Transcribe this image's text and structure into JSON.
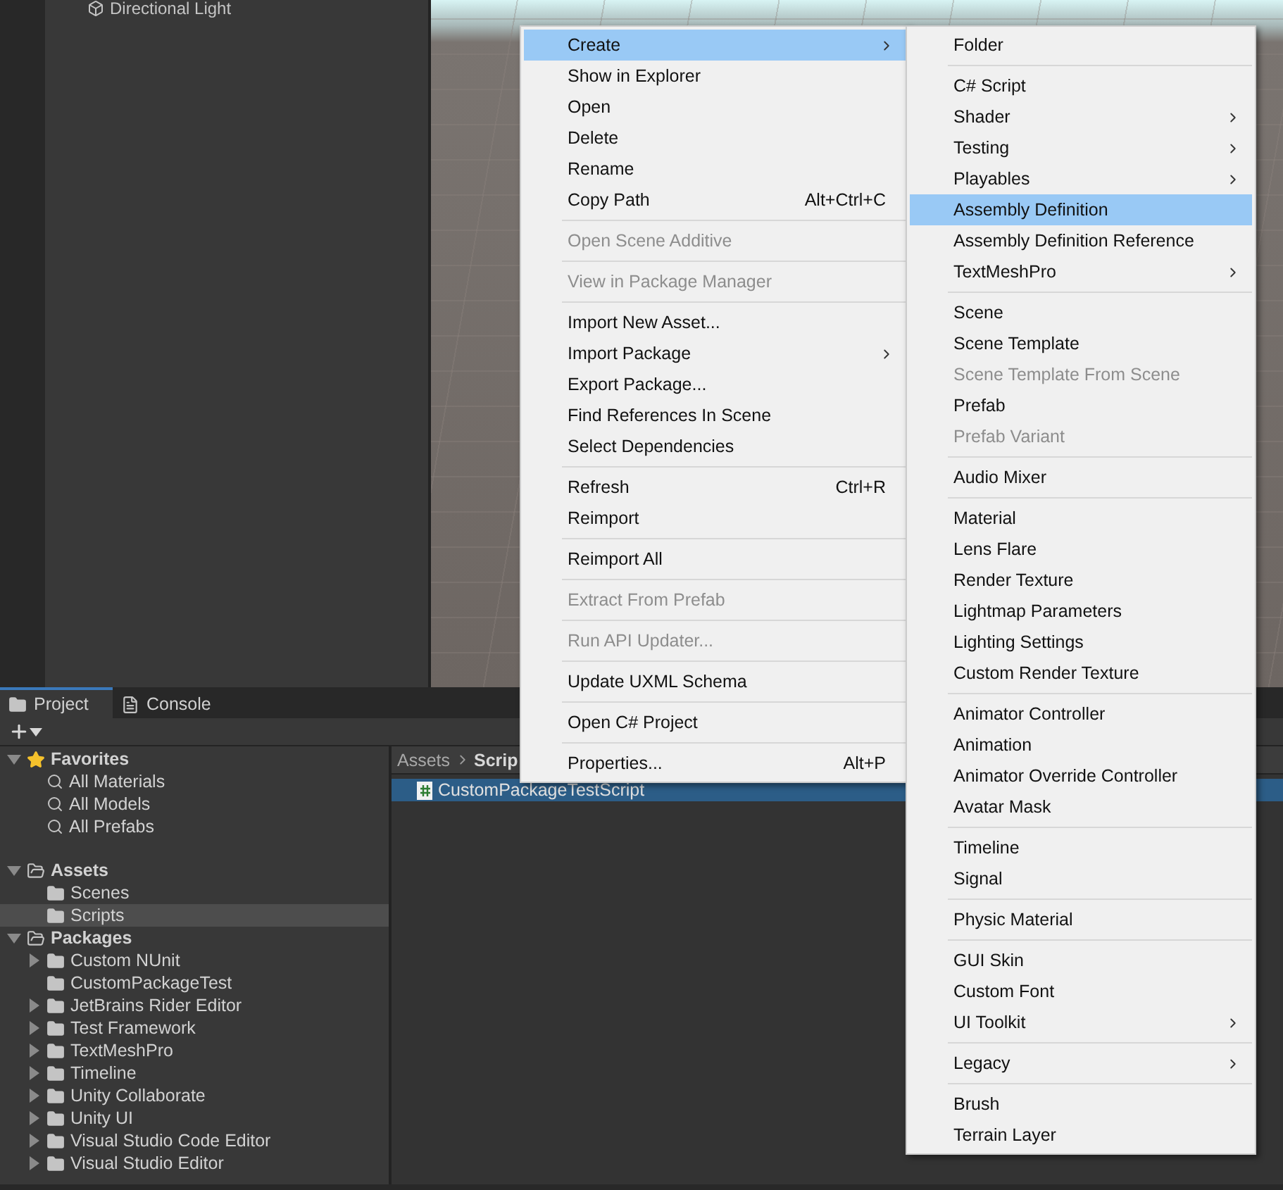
{
  "hierarchy": {
    "items": [
      {
        "label": "Directional Light"
      }
    ]
  },
  "bottom_panel": {
    "tabs": [
      {
        "label": "Project",
        "selected": true
      },
      {
        "label": "Console",
        "selected": false
      }
    ],
    "tree": [
      {
        "kind": "favorites",
        "label": "Favorites",
        "expandable": true,
        "expanded": true,
        "selected": false,
        "children": [
          {
            "kind": "search",
            "label": "All Materials",
            "expandable": false,
            "selected": false
          },
          {
            "kind": "search",
            "label": "All Models",
            "expandable": false,
            "selected": false
          },
          {
            "kind": "search",
            "label": "All Prefabs",
            "expandable": false,
            "selected": false
          }
        ]
      },
      {
        "kind": "folder",
        "label": "Assets",
        "expandable": true,
        "expanded": true,
        "selected": false,
        "children": [
          {
            "kind": "folder",
            "label": "Scenes",
            "expandable": false,
            "selected": false
          },
          {
            "kind": "folder",
            "label": "Scripts",
            "expandable": false,
            "selected": true
          }
        ]
      },
      {
        "kind": "folder",
        "label": "Packages",
        "expandable": true,
        "expanded": true,
        "selected": false,
        "children": [
          {
            "kind": "folder",
            "label": "Custom NUnit",
            "expandable": true,
            "expanded": false,
            "selected": false
          },
          {
            "kind": "folder",
            "label": "CustomPackageTest",
            "expandable": false,
            "selected": false
          },
          {
            "kind": "folder",
            "label": "JetBrains Rider Editor",
            "expandable": true,
            "expanded": false,
            "selected": false
          },
          {
            "kind": "folder",
            "label": "Test Framework",
            "expandable": true,
            "expanded": false,
            "selected": false
          },
          {
            "kind": "folder",
            "label": "TextMeshPro",
            "expandable": true,
            "expanded": false,
            "selected": false
          },
          {
            "kind": "folder",
            "label": "Timeline",
            "expandable": true,
            "expanded": false,
            "selected": false
          },
          {
            "kind": "folder",
            "label": "Unity Collaborate",
            "expandable": true,
            "expanded": false,
            "selected": false
          },
          {
            "kind": "folder",
            "label": "Unity UI",
            "expandable": true,
            "expanded": false,
            "selected": false
          },
          {
            "kind": "folder",
            "label": "Visual Studio Code Editor",
            "expandable": true,
            "expanded": false,
            "selected": false
          },
          {
            "kind": "folder",
            "label": "Visual Studio Editor",
            "expandable": true,
            "expanded": false,
            "selected": false
          }
        ]
      }
    ],
    "breadcrumb": [
      "Assets",
      "Scrip"
    ],
    "files": [
      {
        "label": "CustomPackageTestScript",
        "selected": true
      }
    ]
  },
  "context_menu": {
    "groups": [
      [
        {
          "label": "Create",
          "submenu": true,
          "selected": true,
          "disabled": false
        },
        {
          "label": "Show in Explorer",
          "submenu": false,
          "selected": false,
          "disabled": false
        },
        {
          "label": "Open",
          "submenu": false,
          "selected": false,
          "disabled": false
        },
        {
          "label": "Delete",
          "submenu": false,
          "selected": false,
          "disabled": false
        },
        {
          "label": "Rename",
          "submenu": false,
          "selected": false,
          "disabled": false
        },
        {
          "label": "Copy Path",
          "shortcut": "Alt+Ctrl+C",
          "submenu": false,
          "selected": false,
          "disabled": false
        }
      ],
      [
        {
          "label": "Open Scene Additive",
          "submenu": false,
          "selected": false,
          "disabled": true
        }
      ],
      [
        {
          "label": "View in Package Manager",
          "submenu": false,
          "selected": false,
          "disabled": true
        }
      ],
      [
        {
          "label": "Import New Asset...",
          "submenu": false,
          "selected": false,
          "disabled": false
        },
        {
          "label": "Import Package",
          "submenu": true,
          "selected": false,
          "disabled": false
        },
        {
          "label": "Export Package...",
          "submenu": false,
          "selected": false,
          "disabled": false
        },
        {
          "label": "Find References In Scene",
          "submenu": false,
          "selected": false,
          "disabled": false
        },
        {
          "label": "Select Dependencies",
          "submenu": false,
          "selected": false,
          "disabled": false
        }
      ],
      [
        {
          "label": "Refresh",
          "shortcut": "Ctrl+R",
          "submenu": false,
          "selected": false,
          "disabled": false
        },
        {
          "label": "Reimport",
          "submenu": false,
          "selected": false,
          "disabled": false
        }
      ],
      [
        {
          "label": "Reimport All",
          "submenu": false,
          "selected": false,
          "disabled": false
        }
      ],
      [
        {
          "label": "Extract From Prefab",
          "submenu": false,
          "selected": false,
          "disabled": true
        }
      ],
      [
        {
          "label": "Run API Updater...",
          "submenu": false,
          "selected": false,
          "disabled": true
        }
      ],
      [
        {
          "label": "Update UXML Schema",
          "submenu": false,
          "selected": false,
          "disabled": false
        }
      ],
      [
        {
          "label": "Open C# Project",
          "submenu": false,
          "selected": false,
          "disabled": false
        }
      ],
      [
        {
          "label": "Properties...",
          "shortcut": "Alt+P",
          "submenu": false,
          "selected": false,
          "disabled": false
        }
      ]
    ]
  },
  "create_submenu": {
    "groups": [
      [
        {
          "label": "Folder",
          "submenu": false,
          "selected": false,
          "disabled": false
        }
      ],
      [
        {
          "label": "C# Script",
          "submenu": false,
          "selected": false,
          "disabled": false
        },
        {
          "label": "Shader",
          "submenu": true,
          "selected": false,
          "disabled": false
        },
        {
          "label": "Testing",
          "submenu": true,
          "selected": false,
          "disabled": false
        },
        {
          "label": "Playables",
          "submenu": true,
          "selected": false,
          "disabled": false
        },
        {
          "label": "Assembly Definition",
          "submenu": false,
          "selected": true,
          "disabled": false
        },
        {
          "label": "Assembly Definition Reference",
          "submenu": false,
          "selected": false,
          "disabled": false
        },
        {
          "label": "TextMeshPro",
          "submenu": true,
          "selected": false,
          "disabled": false
        }
      ],
      [
        {
          "label": "Scene",
          "submenu": false,
          "selected": false,
          "disabled": false
        },
        {
          "label": "Scene Template",
          "submenu": false,
          "selected": false,
          "disabled": false
        },
        {
          "label": "Scene Template From Scene",
          "submenu": false,
          "selected": false,
          "disabled": true
        },
        {
          "label": "Prefab",
          "submenu": false,
          "selected": false,
          "disabled": false
        },
        {
          "label": "Prefab Variant",
          "submenu": false,
          "selected": false,
          "disabled": true
        }
      ],
      [
        {
          "label": "Audio Mixer",
          "submenu": false,
          "selected": false,
          "disabled": false
        }
      ],
      [
        {
          "label": "Material",
          "submenu": false,
          "selected": false,
          "disabled": false
        },
        {
          "label": "Lens Flare",
          "submenu": false,
          "selected": false,
          "disabled": false
        },
        {
          "label": "Render Texture",
          "submenu": false,
          "selected": false,
          "disabled": false
        },
        {
          "label": "Lightmap Parameters",
          "submenu": false,
          "selected": false,
          "disabled": false
        },
        {
          "label": "Lighting Settings",
          "submenu": false,
          "selected": false,
          "disabled": false
        },
        {
          "label": "Custom Render Texture",
          "submenu": false,
          "selected": false,
          "disabled": false
        }
      ],
      [
        {
          "label": "Animator Controller",
          "submenu": false,
          "selected": false,
          "disabled": false
        },
        {
          "label": "Animation",
          "submenu": false,
          "selected": false,
          "disabled": false
        },
        {
          "label": "Animator Override Controller",
          "submenu": false,
          "selected": false,
          "disabled": false
        },
        {
          "label": "Avatar Mask",
          "submenu": false,
          "selected": false,
          "disabled": false
        }
      ],
      [
        {
          "label": "Timeline",
          "submenu": false,
          "selected": false,
          "disabled": false
        },
        {
          "label": "Signal",
          "submenu": false,
          "selected": false,
          "disabled": false
        }
      ],
      [
        {
          "label": "Physic Material",
          "submenu": false,
          "selected": false,
          "disabled": false
        }
      ],
      [
        {
          "label": "GUI Skin",
          "submenu": false,
          "selected": false,
          "disabled": false
        },
        {
          "label": "Custom Font",
          "submenu": false,
          "selected": false,
          "disabled": false
        },
        {
          "label": "UI Toolkit",
          "submenu": true,
          "selected": false,
          "disabled": false
        }
      ],
      [
        {
          "label": "Legacy",
          "submenu": true,
          "selected": false,
          "disabled": false
        }
      ],
      [
        {
          "label": "Brush",
          "submenu": false,
          "selected": false,
          "disabled": false
        },
        {
          "label": "Terrain Layer",
          "submenu": false,
          "selected": false,
          "disabled": false
        }
      ]
    ]
  }
}
